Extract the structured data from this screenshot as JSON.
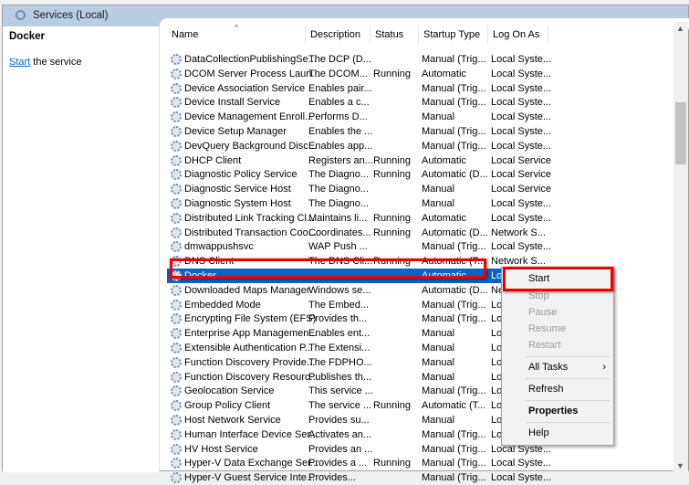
{
  "title": "Services (Local)",
  "left_pane": {
    "service_name": "Docker",
    "action_link": "Start",
    "action_rest": " the service"
  },
  "columns": [
    "Name",
    "Description",
    "Status",
    "Startup Type",
    "Log On As"
  ],
  "rows": [
    [
      "DataCollectionPublishingSe...",
      "The DCP (D...",
      "",
      "Manual (Trig...",
      "Local Syste..."
    ],
    [
      "DCOM Server Process Laun...",
      "The DCOM...",
      "Running",
      "Automatic",
      "Local Syste..."
    ],
    [
      "Device Association Service",
      "Enables pair...",
      "",
      "Manual (Trig...",
      "Local Syste..."
    ],
    [
      "Device Install Service",
      "Enables a c...",
      "",
      "Manual (Trig...",
      "Local Syste..."
    ],
    [
      "Device Management Enroll...",
      "Performs D...",
      "",
      "Manual",
      "Local Syste..."
    ],
    [
      "Device Setup Manager",
      "Enables the ...",
      "",
      "Manual (Trig...",
      "Local Syste..."
    ],
    [
      "DevQuery Background Disc...",
      "Enables app...",
      "",
      "Manual (Trig...",
      "Local Syste..."
    ],
    [
      "DHCP Client",
      "Registers an...",
      "Running",
      "Automatic",
      "Local Service"
    ],
    [
      "Diagnostic Policy Service",
      "The Diagno...",
      "Running",
      "Automatic (D...",
      "Local Service"
    ],
    [
      "Diagnostic Service Host",
      "The Diagno...",
      "",
      "Manual",
      "Local Service"
    ],
    [
      "Diagnostic System Host",
      "The Diagno...",
      "",
      "Manual",
      "Local Syste..."
    ],
    [
      "Distributed Link Tracking Cl...",
      "Maintains li...",
      "Running",
      "Automatic",
      "Local Syste..."
    ],
    [
      "Distributed Transaction Coo...",
      "Coordinates...",
      "Running",
      "Automatic (D...",
      "Network S..."
    ],
    [
      "dmwappushsvc",
      "WAP Push ...",
      "",
      "Manual (Trig...",
      "Local Syste..."
    ],
    [
      "DNS Client",
      "The DNS Cli...",
      "Running",
      "Automatic (T...",
      "Network S..."
    ],
    [
      "Docker",
      "",
      "",
      "Automatic",
      "Local Syste..."
    ],
    [
      "Downloaded Maps Manager",
      "Windows se...",
      "",
      "Automatic (D...",
      "Network S..."
    ],
    [
      "Embedded Mode",
      "The Embed...",
      "",
      "Manual (Trig...",
      "Local Syste..."
    ],
    [
      "Encrypting File System (EFS)",
      "Provides th...",
      "",
      "Manual (Trig...",
      "Local Syste..."
    ],
    [
      "Enterprise App Managemen...",
      "Enables ent...",
      "",
      "Manual",
      "Local Syste..."
    ],
    [
      "Extensible Authentication P...",
      "The Extensi...",
      "",
      "Manual",
      "Local Syste..."
    ],
    [
      "Function Discovery Provide...",
      "The FDPHO...",
      "",
      "Manual",
      "Local Service"
    ],
    [
      "Function Discovery Resourc...",
      "Publishes th...",
      "",
      "Manual",
      "Local Service"
    ],
    [
      "Geolocation Service",
      "This service ...",
      "",
      "Manual (Trig...",
      "Local Syste..."
    ],
    [
      "Group Policy Client",
      "The service ...",
      "Running",
      "Automatic (T...",
      "Local Syste..."
    ],
    [
      "Host Network Service",
      "Provides su...",
      "",
      "Manual",
      "Local Syste..."
    ],
    [
      "Human Interface Device Ser...",
      "Activates an...",
      "",
      "Manual (Trig...",
      "Local Syste..."
    ],
    [
      "HV Host Service",
      "Provides an ...",
      "",
      "Manual (Trig...",
      "Local Syste..."
    ],
    [
      "Hyper-V Data Exchange Ser...",
      "Provides a ...",
      "Running",
      "Manual (Trig...",
      "Local Syste..."
    ],
    [
      "Hyper-V Guest Service Inte...",
      "Provides...",
      "",
      "Manual (Trig...",
      "Local Syste..."
    ]
  ],
  "selected_row": 15,
  "context_menu": {
    "start": "Start",
    "stop": "Stop",
    "pause": "Pause",
    "resume": "Resume",
    "restart": "Restart",
    "all_tasks": "All Tasks",
    "refresh": "Refresh",
    "properties": "Properties",
    "help": "Help"
  },
  "colors": {
    "selection": "#0a64c8",
    "highlight": "#e00000"
  }
}
